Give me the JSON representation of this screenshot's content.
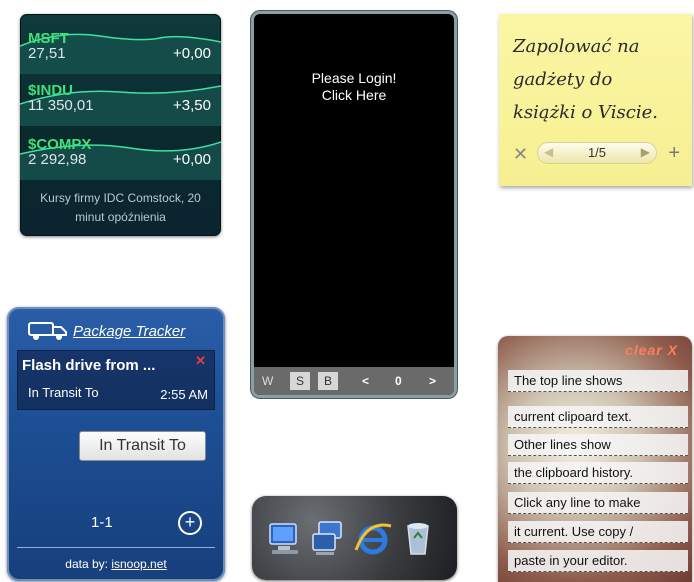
{
  "stocks": {
    "rows": [
      {
        "ticker": "MSFT",
        "price": "27,51",
        "change": "+0,00"
      },
      {
        "ticker": "$INDU",
        "price": "11 350,01",
        "change": "+3,50"
      },
      {
        "ticker": "$COMPX",
        "price": "2 292,98",
        "change": "+0,00"
      }
    ],
    "footer_line1": "Kursy firmy IDC Comstock, 20",
    "footer_line2": "minut opóźnienia"
  },
  "login": {
    "message_line1": "Please Login!",
    "message_line2": "Click Here",
    "bar": {
      "w": "W",
      "s": "S",
      "b": "B",
      "prev": "<",
      "count": "0",
      "next": ">"
    }
  },
  "note": {
    "lines": [
      "Zapolować na",
      "gadżety do",
      "książki o Viscie."
    ],
    "page": "1/5",
    "delete_glyph": "✕",
    "add_glyph": "+"
  },
  "package_tracker": {
    "title": "Package Tracker",
    "item_name": "Flash drive from ...",
    "status": "In Transit To",
    "time": "2:55 AM",
    "button": "In Transit To",
    "count": "1-1",
    "credit_prefix": "data by:",
    "credit_link": "isnoop.net"
  },
  "dock": {
    "icons": [
      "computer-icon",
      "network-icon",
      "internet-explorer-icon",
      "recycle-bin-icon"
    ]
  },
  "clipboard": {
    "clear_label": "clear X",
    "lines": [
      "The top line shows",
      "current clipoard text.",
      "Other lines show",
      "the clipboard history.",
      "Click any line to make",
      "it current. Use copy /",
      "paste in your editor."
    ]
  }
}
